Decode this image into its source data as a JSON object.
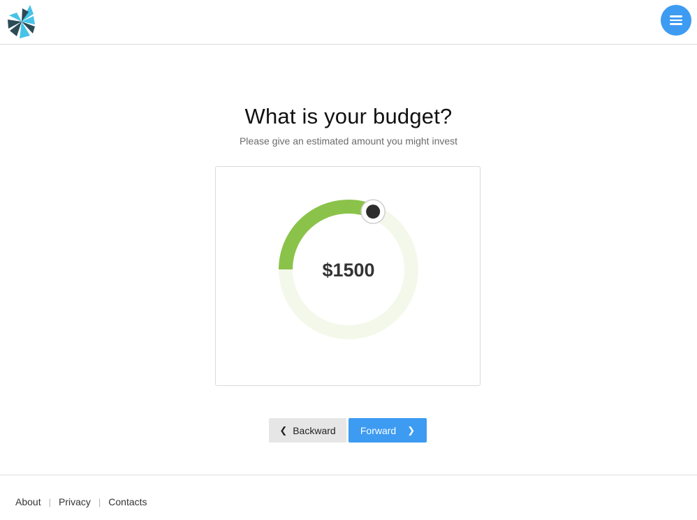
{
  "header": {
    "logo_icon": "pinwheel-logo",
    "menu_icon": "hamburger-menu-icon",
    "colors": {
      "menu_button": "#3d9bf2",
      "logo_light": "#47c3e8",
      "logo_dark": "#2b4b57"
    }
  },
  "main": {
    "title": "What is your budget?",
    "subtitle": "Please give an estimated amount you might invest"
  },
  "budget_dial": {
    "value_label": "$1500",
    "progress_fraction": 0.3,
    "colors": {
      "filled": "#8bc34a",
      "track": "#f3f8ea",
      "knob": "#2d2d2d"
    }
  },
  "navigation": {
    "backward_label": "Backward",
    "forward_label": "Forward",
    "backward_icon": "chevron-left-icon",
    "forward_icon": "chevron-right-icon",
    "colors": {
      "forward_bg": "#3d9bf2",
      "backward_bg": "#e6e6e6"
    }
  },
  "footer": {
    "links": [
      "About",
      "Privacy",
      "Contacts"
    ]
  }
}
